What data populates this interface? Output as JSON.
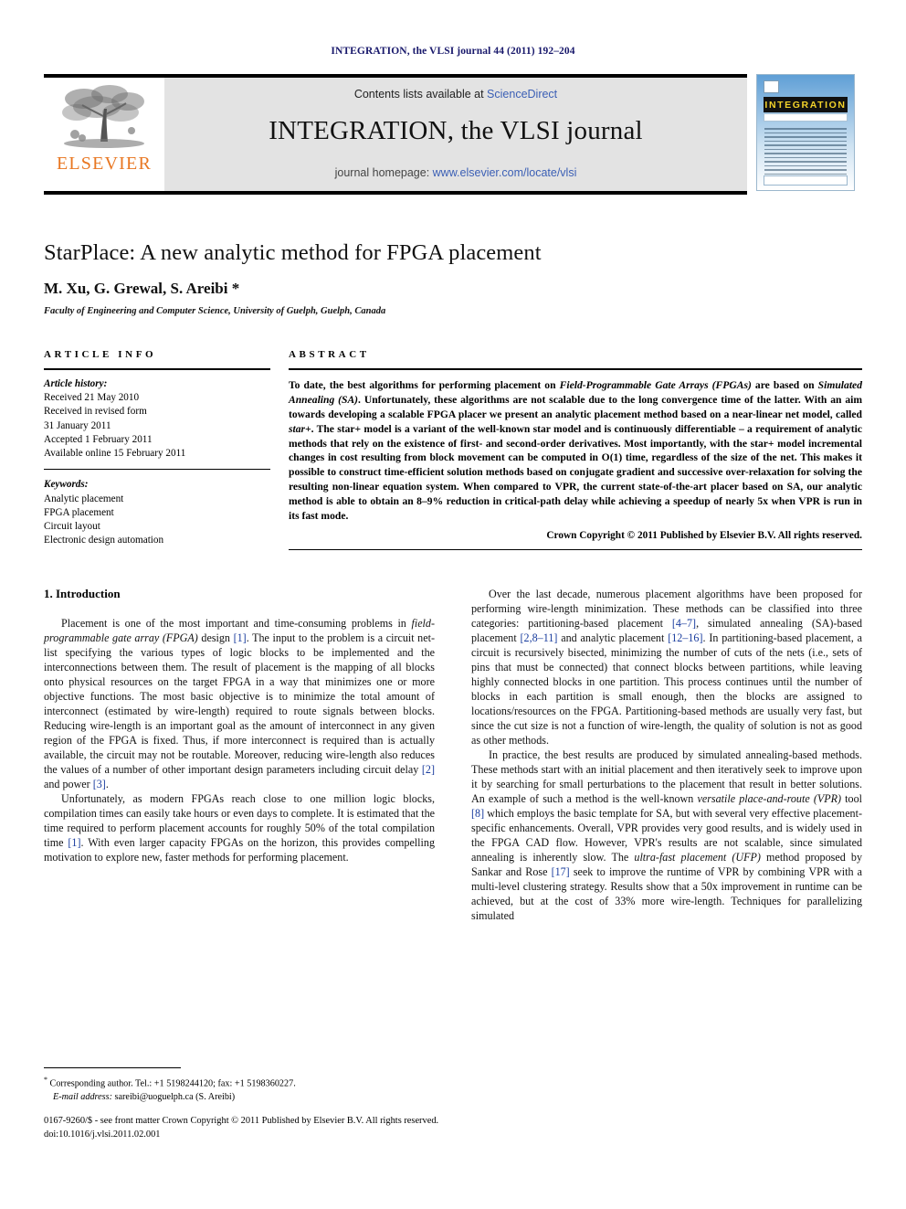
{
  "running_head": "INTEGRATION, the VLSI journal 44 (2011) 192–204",
  "masthead": {
    "contents_prefix": "Contents lists available at ",
    "sciencedirect": "ScienceDirect",
    "journal_title": "INTEGRATION, the VLSI journal",
    "homepage_prefix": "journal homepage: ",
    "homepage_url": "www.elsevier.com/locate/vlsi",
    "publisher_logo_text": "ELSEVIER",
    "cover_band_text": "INTEGRATION",
    "accent_blue": "#3b5fb5",
    "elsevier_orange": "#E87722",
    "cover_yellow": "#f2d22a"
  },
  "title_block": {
    "title": "StarPlace: A new analytic method for FPGA placement",
    "authors": "M. Xu, G. Grewal, S. Areibi *",
    "affiliation": "Faculty of Engineering and Computer Science, University of Guelph, Guelph, Canada"
  },
  "article_info": {
    "heading": "ARTICLE INFO",
    "history_label": "Article history:",
    "history": [
      "Received 21 May 2010",
      "Received in revised form",
      "31 January 2011",
      "Accepted 1 February 2011",
      "Available online 15 February 2011"
    ],
    "keywords_label": "Keywords:",
    "keywords": [
      "Analytic placement",
      "FPGA placement",
      "Circuit layout",
      "Electronic design automation"
    ]
  },
  "abstract": {
    "heading": "ABSTRACT",
    "text_parts": [
      {
        "t": "To date, the best algorithms for performing placement on ",
        "i": false
      },
      {
        "t": "Field-Programmable Gate Arrays (FPGAs)",
        "i": true
      },
      {
        "t": " are based on ",
        "i": false
      },
      {
        "t": "Simulated Annealing (SA)",
        "i": true
      },
      {
        "t": ". Unfortunately, these algorithms are not scalable due to the long convergence time of the latter. With an aim towards developing a scalable FPGA placer we present an analytic placement method based on a near-linear net model, called ",
        "i": false
      },
      {
        "t": "star+",
        "i": true
      },
      {
        "t": ". The star+ model is a variant of the well-known star model and is continuously differentiable – a requirement of analytic methods that rely on the existence of first- and second-order derivatives. Most importantly, with the star+ model incremental changes in cost resulting from block movement can be computed in O(1) time, regardless of the size of the net. This makes it possible to construct time-efficient solution methods based on conjugate gradient and successive over-relaxation for solving the resulting non-linear equation system. When compared to VPR, the current state-of-the-art placer based on SA, our analytic method is able to obtain an 8–9% reduction in critical-path delay while achieving a speedup of nearly 5x when VPR is run in its fast mode.",
        "i": false
      }
    ],
    "copyright": "Crown Copyright © 2011 Published by Elsevier B.V. All rights reserved."
  },
  "body": {
    "section_title": "1.  Introduction",
    "left_paragraphs": [
      [
        {
          "t": "Placement is one of the most important and time-consuming problems in ",
          "k": "n"
        },
        {
          "t": "field-programmable gate array (FPGA)",
          "k": "i"
        },
        {
          "t": " design ",
          "k": "n"
        },
        {
          "t": "[1]",
          "k": "c"
        },
        {
          "t": ". The input to the problem is a circuit net-list specifying the various types of logic blocks to be implemented and the interconnections between them. The result of placement is the mapping of all blocks onto physical resources on the target FPGA in a way that minimizes one or more objective functions. The most basic objective is to minimize the total amount of interconnect (estimated by wire-length) required to route signals between blocks. Reducing wire-length is an important goal as the amount of interconnect in any given region of the FPGA is fixed. Thus, if more interconnect is required than is actually available, the circuit may not be routable. Moreover, reducing wire-length also reduces the values of a number of other important design parameters including circuit delay ",
          "k": "n"
        },
        {
          "t": "[2]",
          "k": "c"
        },
        {
          "t": " and power ",
          "k": "n"
        },
        {
          "t": "[3]",
          "k": "c"
        },
        {
          "t": ".",
          "k": "n"
        }
      ],
      [
        {
          "t": "Unfortunately, as modern FPGAs reach close to one million logic blocks, compilation times can easily take hours or even days to complete. It is estimated that the time required to perform placement accounts for roughly 50% of the total compilation time ",
          "k": "n"
        },
        {
          "t": "[1]",
          "k": "c"
        },
        {
          "t": ". With even larger capacity FPGAs on the horizon, this provides compelling motivation to explore new, faster methods for performing placement.",
          "k": "n"
        }
      ]
    ],
    "right_paragraphs": [
      [
        {
          "t": "Over the last decade, numerous placement algorithms have been proposed for performing wire-length minimization. These methods can be classified into three categories: partitioning-based placement ",
          "k": "n"
        },
        {
          "t": "[4–7]",
          "k": "c"
        },
        {
          "t": ", simulated annealing (SA)-based placement ",
          "k": "n"
        },
        {
          "t": "[2,8–11]",
          "k": "c"
        },
        {
          "t": " and analytic placement ",
          "k": "n"
        },
        {
          "t": "[12–16]",
          "k": "c"
        },
        {
          "t": ". In partitioning-based placement, a circuit is recursively bisected, minimizing the number of cuts of the nets (i.e., sets of pins that must be connected) that connect blocks between partitions, while leaving highly connected blocks in one partition. This process continues until the number of blocks in each partition is small enough, then the blocks are assigned to locations/resources on the FPGA. Partitioning-based methods are usually very fast, but since the cut size is not a function of wire-length, the quality of solution is not as good as other methods.",
          "k": "n"
        }
      ],
      [
        {
          "t": "In practice, the best results are produced by simulated annealing-based methods. These methods start with an initial placement and then iteratively seek to improve upon it by searching for small perturbations to the placement that result in better solutions. An example of such a method is the well-known ",
          "k": "n"
        },
        {
          "t": "versatile place-and-route (VPR)",
          "k": "i"
        },
        {
          "t": " tool ",
          "k": "n"
        },
        {
          "t": "[8]",
          "k": "c"
        },
        {
          "t": " which employs the basic template for SA, but with several very effective placement-specific enhancements. Overall, VPR provides very good results, and is widely used in the FPGA CAD flow. However, VPR's results are not scalable, since simulated annealing is inherently slow. The ",
          "k": "n"
        },
        {
          "t": "ultra-fast placement (UFP)",
          "k": "i"
        },
        {
          "t": " method proposed by Sankar and Rose ",
          "k": "n"
        },
        {
          "t": "[17]",
          "k": "c"
        },
        {
          "t": " seek to improve the runtime of VPR by combining VPR with a multi-level clustering strategy. Results show that a 50x improvement in runtime can be achieved, but at the cost of 33% more wire-length. Techniques for parallelizing simulated",
          "k": "n"
        }
      ]
    ]
  },
  "footnotes": {
    "corresponding": "Corresponding author. Tel.: +1 5198244120; fax: +1 5198360227.",
    "email_label": "E-mail address:",
    "email": " sareibi@uoguelph.ca (S. Areibi)"
  },
  "footer": {
    "issn_line": "0167-9260/$ - see front matter Crown Copyright © 2011 Published by Elsevier B.V. All rights reserved.",
    "doi": "doi:10.1016/j.vlsi.2011.02.001"
  }
}
